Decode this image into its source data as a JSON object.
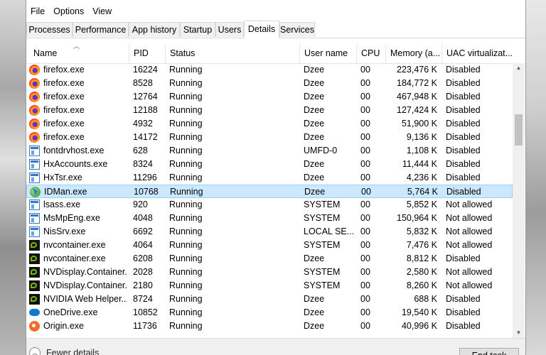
{
  "menu": [
    "File",
    "Options",
    "View"
  ],
  "tabs": [
    {
      "label": "Processes",
      "active": false
    },
    {
      "label": "Performance",
      "active": false
    },
    {
      "label": "App history",
      "active": false
    },
    {
      "label": "Startup",
      "active": false
    },
    {
      "label": "Users",
      "active": false
    },
    {
      "label": "Details",
      "active": true
    },
    {
      "label": "Services",
      "active": false
    }
  ],
  "columns": [
    "Name",
    "PID",
    "Status",
    "User name",
    "CPU",
    "Memory (a...",
    "UAC virtualizat..."
  ],
  "rows": [
    {
      "icon": "firefox",
      "name": "firefox.exe",
      "pid": "16224",
      "status": "Running",
      "user": "Dzee",
      "cpu": "00",
      "memory": "223,476 K",
      "uac": "Disabled"
    },
    {
      "icon": "firefox",
      "name": "firefox.exe",
      "pid": "8528",
      "status": "Running",
      "user": "Dzee",
      "cpu": "00",
      "memory": "184,772 K",
      "uac": "Disabled"
    },
    {
      "icon": "firefox",
      "name": "firefox.exe",
      "pid": "12764",
      "status": "Running",
      "user": "Dzee",
      "cpu": "00",
      "memory": "467,948 K",
      "uac": "Disabled"
    },
    {
      "icon": "firefox",
      "name": "firefox.exe",
      "pid": "12188",
      "status": "Running",
      "user": "Dzee",
      "cpu": "00",
      "memory": "127,424 K",
      "uac": "Disabled"
    },
    {
      "icon": "firefox",
      "name": "firefox.exe",
      "pid": "4932",
      "status": "Running",
      "user": "Dzee",
      "cpu": "00",
      "memory": "51,900 K",
      "uac": "Disabled"
    },
    {
      "icon": "firefox",
      "name": "firefox.exe",
      "pid": "14172",
      "status": "Running",
      "user": "Dzee",
      "cpu": "00",
      "memory": "9,136 K",
      "uac": "Disabled"
    },
    {
      "icon": "win",
      "name": "fontdrvhost.exe",
      "pid": "628",
      "status": "Running",
      "user": "UMFD-0",
      "cpu": "00",
      "memory": "1,108 K",
      "uac": "Disabled"
    },
    {
      "icon": "win",
      "name": "HxAccounts.exe",
      "pid": "8324",
      "status": "Running",
      "user": "Dzee",
      "cpu": "00",
      "memory": "11,444 K",
      "uac": "Disabled"
    },
    {
      "icon": "win",
      "name": "HxTsr.exe",
      "pid": "11296",
      "status": "Running",
      "user": "Dzee",
      "cpu": "00",
      "memory": "4,236 K",
      "uac": "Disabled"
    },
    {
      "icon": "idm",
      "name": "IDMan.exe",
      "pid": "10768",
      "status": "Running",
      "user": "Dzee",
      "cpu": "00",
      "memory": "5,764 K",
      "uac": "Disabled",
      "selected": true
    },
    {
      "icon": "win",
      "name": "lsass.exe",
      "pid": "920",
      "status": "Running",
      "user": "SYSTEM",
      "cpu": "00",
      "memory": "5,852 K",
      "uac": "Not allowed"
    },
    {
      "icon": "win",
      "name": "MsMpEng.exe",
      "pid": "4048",
      "status": "Running",
      "user": "SYSTEM",
      "cpu": "00",
      "memory": "150,964 K",
      "uac": "Not allowed"
    },
    {
      "icon": "win",
      "name": "NisSrv.exe",
      "pid": "6692",
      "status": "Running",
      "user": "LOCAL SE...",
      "cpu": "00",
      "memory": "5,832 K",
      "uac": "Not allowed"
    },
    {
      "icon": "nvidia",
      "name": "nvcontainer.exe",
      "pid": "4064",
      "status": "Running",
      "user": "SYSTEM",
      "cpu": "00",
      "memory": "7,476 K",
      "uac": "Not allowed"
    },
    {
      "icon": "nvidia",
      "name": "nvcontainer.exe",
      "pid": "6208",
      "status": "Running",
      "user": "Dzee",
      "cpu": "00",
      "memory": "8,812 K",
      "uac": "Disabled"
    },
    {
      "icon": "nvidia",
      "name": "NVDisplay.Container...",
      "pid": "2028",
      "status": "Running",
      "user": "SYSTEM",
      "cpu": "00",
      "memory": "2,580 K",
      "uac": "Not allowed"
    },
    {
      "icon": "nvidia",
      "name": "NVDisplay.Container...",
      "pid": "2180",
      "status": "Running",
      "user": "SYSTEM",
      "cpu": "00",
      "memory": "8,260 K",
      "uac": "Not allowed"
    },
    {
      "icon": "nvidia",
      "name": "NVIDIA Web Helper....",
      "pid": "8724",
      "status": "Running",
      "user": "Dzee",
      "cpu": "00",
      "memory": "688 K",
      "uac": "Disabled"
    },
    {
      "icon": "onedrive",
      "name": "OneDrive.exe",
      "pid": "10852",
      "status": "Running",
      "user": "Dzee",
      "cpu": "00",
      "memory": "19,540 K",
      "uac": "Disabled"
    },
    {
      "icon": "origin",
      "name": "Origin.exe",
      "pid": "11736",
      "status": "Running",
      "user": "Dzee",
      "cpu": "00",
      "memory": "40,996 K",
      "uac": "Disabled"
    }
  ],
  "footer": {
    "fewer_details": "Fewer details",
    "end_task": "End task"
  }
}
